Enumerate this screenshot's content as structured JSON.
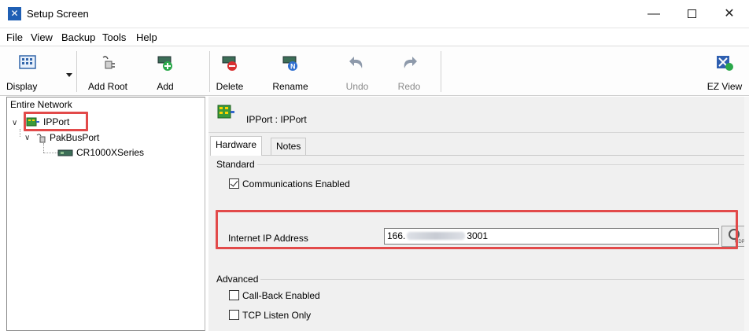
{
  "window": {
    "title": "Setup Screen",
    "minimize_glyph": "—",
    "close_glyph": "✕"
  },
  "menu": [
    "File",
    "View",
    "Backup",
    "Tools",
    "Help"
  ],
  "toolbar": {
    "display": "Display",
    "add_root": "Add Root",
    "add": "Add",
    "delete": "Delete",
    "rename": "Rename",
    "undo": "Undo",
    "redo": "Redo",
    "ez_view": "EZ View"
  },
  "tree": {
    "title": "Entire Network",
    "nodes": [
      {
        "label": "IPPort",
        "icon": "ipport-icon",
        "selected": true
      },
      {
        "label": "PakBusPort",
        "icon": "pakbusport-icon"
      },
      {
        "label": "CR1000XSeries",
        "icon": "datalogger-icon"
      }
    ]
  },
  "detail": {
    "header": "IPPort : IPPort",
    "tabs": [
      "Hardware",
      "Notes"
    ],
    "active_tab": "Hardware",
    "standard_group": "Standard",
    "comms_enabled_label": "Communications Enabled",
    "comms_enabled": true,
    "ip_label": "Internet IP Address",
    "ip_value_prefix": "166.",
    "ip_value_suffix": "3001",
    "udp_label": "UDP",
    "advanced_group": "Advanced",
    "callback_label": "Call-Back Enabled",
    "callback_enabled": false,
    "tcp_listen_label": "TCP Listen Only",
    "tcp_listen_enabled": false
  },
  "colors": {
    "highlight": "#e24a4a",
    "panel_bg": "#f0f0f0",
    "app_icon": "#1f5fb4"
  }
}
